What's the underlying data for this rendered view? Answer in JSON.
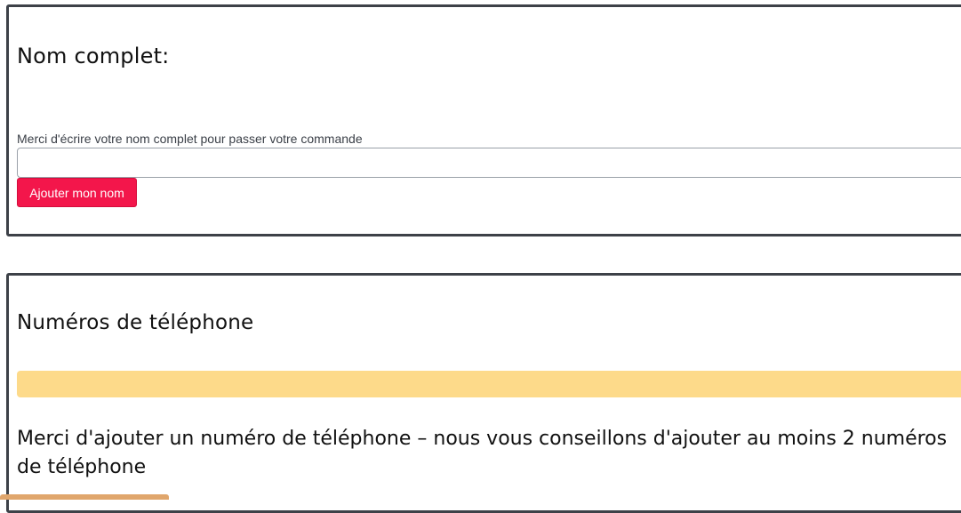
{
  "name_section": {
    "heading": "Nom complet:",
    "field_label": "Merci d'écrire votre nom complet pour passer votre commande",
    "field_value": "",
    "field_placeholder": "",
    "button_label": "Ajouter mon nom"
  },
  "phone_section": {
    "heading": "Numéros de téléphone",
    "note": "Merci d'ajouter un numéro de téléphone – nous vous conseillons d'ajouter au moins 2 numéros de téléphone"
  },
  "colors": {
    "primary_button": "#f3164b",
    "alert_bar": "#fdda8a",
    "card_border": "#3d4148",
    "bottom_tab": "#e0a66c"
  }
}
